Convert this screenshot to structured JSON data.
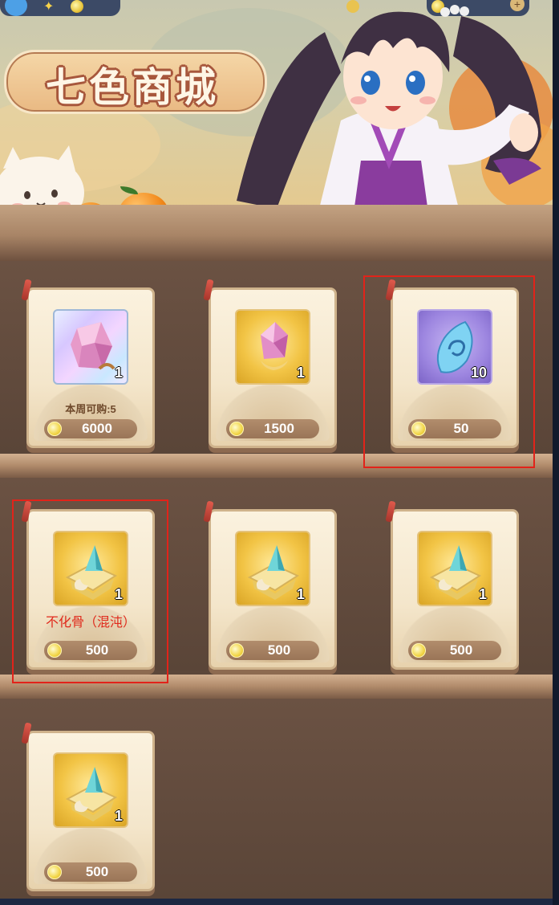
{
  "banner": {
    "title": "七色商城"
  },
  "items": [
    {
      "quantity": "1",
      "limit_label": "本周可购:5",
      "price": "6000",
      "icon": "pink-crystal-icon",
      "frame": "holo"
    },
    {
      "quantity": "1",
      "limit_label": "",
      "price": "1500",
      "icon": "pink-crystal-icon",
      "frame": "gold"
    },
    {
      "quantity": "10",
      "limit_label": "",
      "price": "50",
      "icon": "blue-jade-icon",
      "frame": "purple"
    },
    {
      "quantity": "1",
      "limit_label": "",
      "price": "500",
      "icon": "bone-fragment-icon",
      "frame": "gold",
      "annotation": "不化骨（混沌）"
    },
    {
      "quantity": "1",
      "limit_label": "",
      "price": "500",
      "icon": "bone-fragment-icon",
      "frame": "gold"
    },
    {
      "quantity": "1",
      "limit_label": "",
      "price": "500",
      "icon": "bone-fragment-icon",
      "frame": "gold"
    },
    {
      "quantity": "1",
      "limit_label": "",
      "price": "500",
      "icon": "bone-fragment-icon",
      "frame": "gold"
    }
  ],
  "colors": {
    "highlight": "#e2231a",
    "annotation": "#e02a1c",
    "price_pill": "#9a7557"
  }
}
